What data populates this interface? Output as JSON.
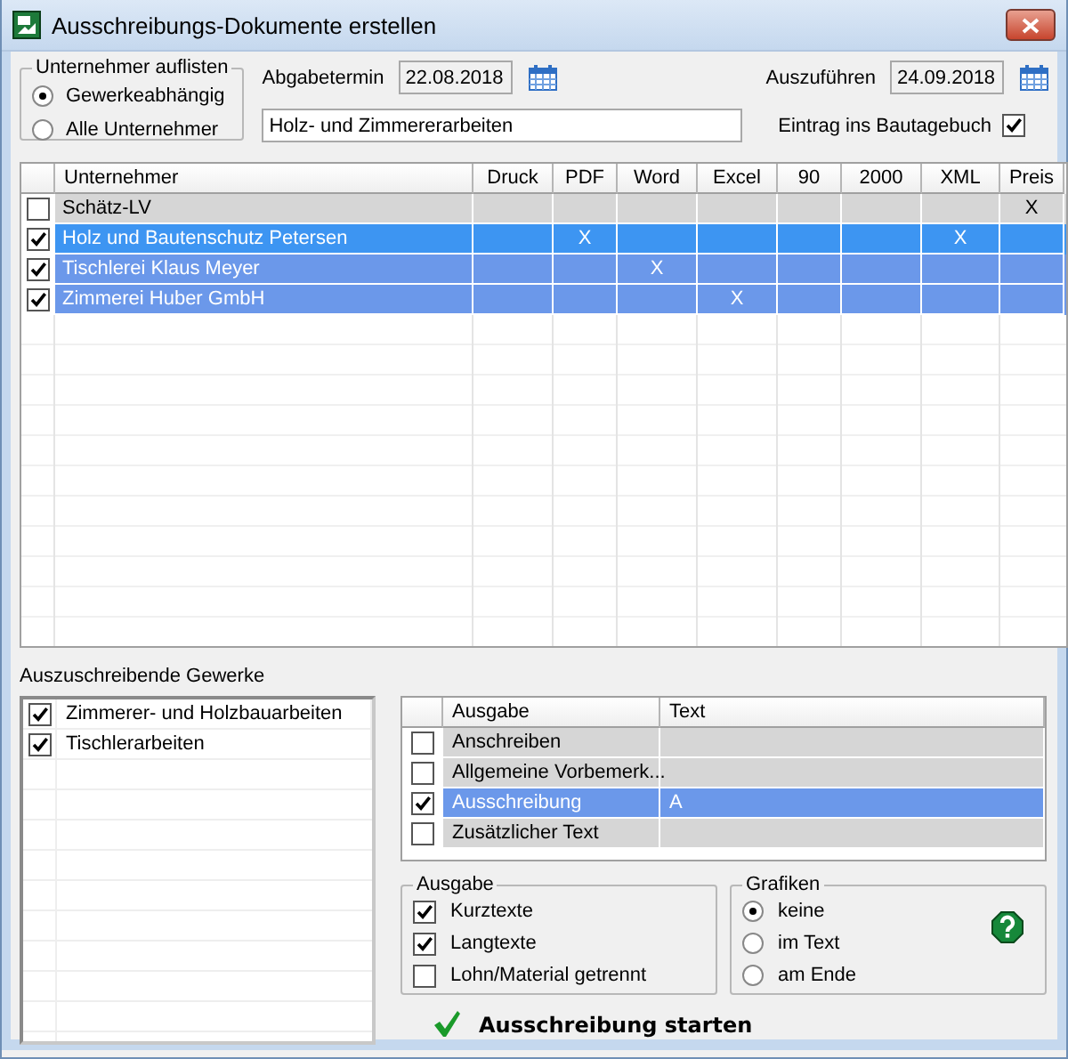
{
  "window": {
    "title": "Ausschreibungs-Dokumente erstellen"
  },
  "list_filter": {
    "title": "Unternehmer auflisten",
    "options": [
      {
        "label": "Gewerkeabhängig",
        "selected": true
      },
      {
        "label": "Alle Unternehmer",
        "selected": false
      }
    ]
  },
  "submission_date": {
    "label": "Abgabetermin",
    "value": "22.08.2018"
  },
  "execution_date": {
    "label": "Auszuführen",
    "value": "24.09.2018"
  },
  "description": {
    "value": "Holz- und Zimmererarbeiten"
  },
  "site_diary": {
    "label": "Eintrag ins Bautagebuch",
    "checked": true
  },
  "contractors": {
    "columns": [
      "Unternehmer",
      "Druck",
      "PDF",
      "Word",
      "Excel",
      "90",
      "2000",
      "XML",
      "Preis"
    ],
    "rows": [
      {
        "checked": false,
        "selected": false,
        "focused": false,
        "cells": [
          "Schätz-LV",
          "",
          "",
          "",
          "",
          "",
          "",
          "",
          "X"
        ]
      },
      {
        "checked": true,
        "selected": true,
        "focused": true,
        "cells": [
          "Holz und Bautenschutz Petersen",
          "",
          "X",
          "",
          "",
          "",
          "",
          "X",
          ""
        ]
      },
      {
        "checked": true,
        "selected": true,
        "focused": false,
        "cells": [
          "Tischlerei Klaus Meyer",
          "",
          "",
          "X",
          "",
          "",
          "",
          "",
          ""
        ]
      },
      {
        "checked": true,
        "selected": true,
        "focused": false,
        "cells": [
          "Zimmerei Huber GmbH",
          "",
          "",
          "",
          "X",
          "",
          "",
          "",
          ""
        ]
      }
    ]
  },
  "trades": {
    "title": "Auszuschreibende Gewerke",
    "items": [
      {
        "label": "Zimmerer- und Holzbauarbeiten",
        "checked": true
      },
      {
        "label": "Tischlerarbeiten",
        "checked": true
      }
    ]
  },
  "outputs": {
    "columns": [
      "Ausgabe",
      "Text"
    ],
    "rows": [
      {
        "label": "Anschreiben",
        "checked": false,
        "selected": false
      },
      {
        "label": "Allgemeine Vorbemerk...",
        "checked": false,
        "selected": false
      },
      {
        "label": "Ausschreibung",
        "text": "A",
        "checked": true,
        "selected": true
      },
      {
        "label": "Zusätzlicher Text",
        "checked": false,
        "selected": false
      }
    ]
  },
  "output_options": {
    "title": "Ausgabe",
    "options": [
      {
        "label": "Kurztexte",
        "checked": true
      },
      {
        "label": "Langtexte",
        "checked": true
      },
      {
        "label": "Lohn/Material getrennt",
        "checked": false
      }
    ]
  },
  "graphics": {
    "title": "Grafiken",
    "options": [
      {
        "label": "keine",
        "selected": true
      },
      {
        "label": "im Text",
        "selected": false
      },
      {
        "label": "am Ende",
        "selected": false
      }
    ]
  },
  "start_button": {
    "label": "Ausschreibung starten"
  }
}
